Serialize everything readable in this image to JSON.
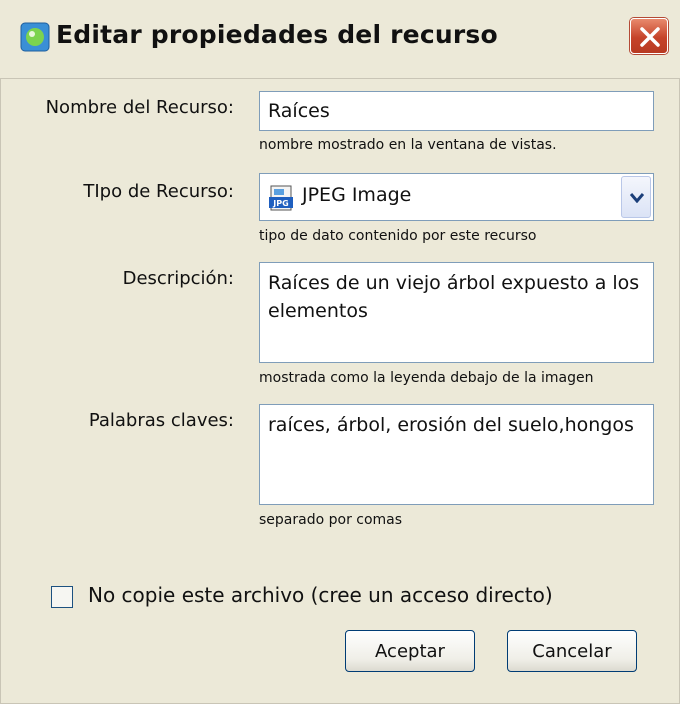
{
  "window": {
    "title": "Editar propiedades del recurso",
    "icon": "app-icon",
    "close_icon": "close-icon"
  },
  "form": {
    "name": {
      "label": "Nombre del Recurso:",
      "value": "Raíces",
      "hint": "nombre mostrado en la ventana de vistas."
    },
    "type": {
      "label": "TIpo de Recurso:",
      "value": "JPEG Image",
      "icon": "jpeg-file-icon",
      "hint": "tipo de dato contenido por este recurso"
    },
    "description": {
      "label": "Descripción:",
      "value": "Raíces de un viejo árbol expuesto a los elementos",
      "hint": "mostrada como la leyenda debajo de la imagen"
    },
    "keywords": {
      "label": "Palabras claves:",
      "value": "raíces, árbol, erosión del suelo,hongos",
      "hint": "separado por comas"
    },
    "no_copy": {
      "label": "No copie este archivo  (cree un acceso directo)",
      "checked": false
    }
  },
  "buttons": {
    "ok": "Aceptar",
    "cancel": "Cancelar"
  }
}
